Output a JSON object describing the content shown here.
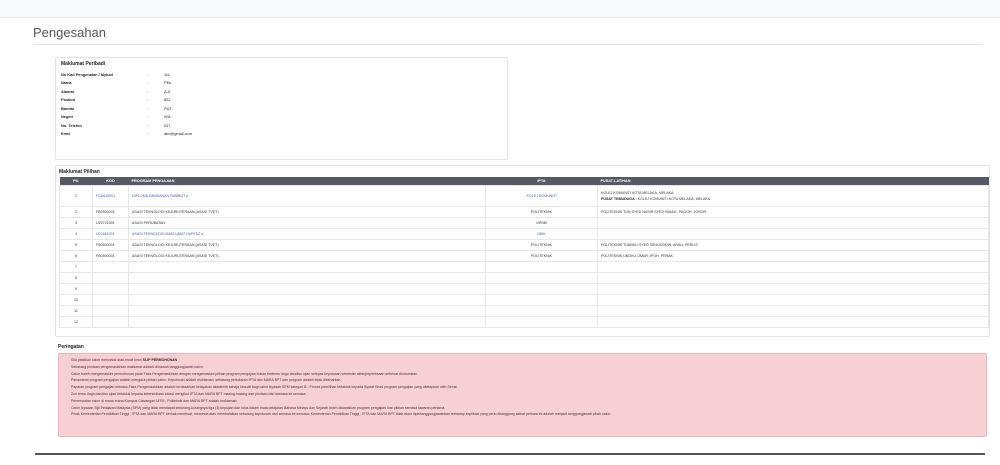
{
  "page": {
    "title": "Pengesahan"
  },
  "personal": {
    "title": "Maklumat Peribadi",
    "separator": ":",
    "fields": [
      {
        "label": "No Kad Pengenalan / Mykad",
        "value": "111"
      },
      {
        "label": "Nama",
        "value": "PEk"
      },
      {
        "label": "Alamat",
        "value": "A-0"
      },
      {
        "label": "Poskod",
        "value": "822"
      },
      {
        "label": "Bandar",
        "value": "PUT"
      },
      {
        "label": "Negeri",
        "value": "WIL"
      },
      {
        "label": "No. Telefon",
        "value": "017"
      },
      {
        "label": "Emel",
        "value": "abc@gmail.com"
      }
    ]
  },
  "choices": {
    "title": "Maklumat Pilihan",
    "headers": {
      "pil": "PIL",
      "kod": "KOD",
      "program": "PROGRAM PENGAJIAN",
      "ipta": "IPTA",
      "pusat": "PUSAT LATIHAN"
    },
    "rows": [
      {
        "pil": "1",
        "kod": "FCA615001",
        "program": "DIPLOMA DANDANAN RAMBUT #",
        "ipta": "KOLEJ KOMUNITI",
        "pusat": "KOLEJ KOMUNITI KOTA MELAKA, MELAKA",
        "pusat_label": "PUSAT TEMUDUGA :",
        "pusat_extra": "KOLEJ KOMUNITI KOTA MELAKA, MELAKA",
        "link": true
      },
      {
        "pil": "2",
        "kod": "FB0500001",
        "program": "ASASI TEKNOLOGI KEJURUTERAAN (ASASI TVET)",
        "ipta": "POLITEKNIK",
        "pusat": "POLITEKNIK TUN SYED NASIR SYED ISMAIL, PAGOH, JOHOR",
        "link": false
      },
      {
        "pil": "3",
        "kod": "UZ0721001",
        "program": "ASASI PERUBATAN",
        "ipta": "UPNM",
        "pusat": "",
        "link": false
      },
      {
        "pil": "4",
        "kod": "UL0481001",
        "program": "ASASI TEKNOLOGI MAKLUMAT HUFFAZ #",
        "ipta": "UNIK",
        "pusat": "",
        "link": true
      },
      {
        "pil": "5",
        "kod": "FB0500001",
        "program": "ASASI TEKNOLOGI KEJURUTERAAN (ASASI TVET)",
        "ipta": "POLITEKNIK",
        "pusat": "POLITEKNIK TUANKU SYED SIRAJUDDIN, ARAU, PERLIS",
        "link": false
      },
      {
        "pil": "6",
        "kod": "FB0500001",
        "program": "ASASI TEKNOLOGI KEJURUTERAAN (ASASI TVET)",
        "ipta": "POLITEKNIK",
        "pusat": "POLITEKNIK UNGKU OMAR, IPOH, PERAK",
        "link": false
      },
      {
        "pil": "7",
        "kod": "",
        "program": "",
        "ipta": "",
        "pusat": "",
        "link": false
      },
      {
        "pil": "8",
        "kod": "",
        "program": "",
        "ipta": "",
        "pusat": "",
        "link": false
      },
      {
        "pil": "9",
        "kod": "",
        "program": "",
        "ipta": "",
        "pusat": "",
        "link": false
      },
      {
        "pil": "10",
        "kod": "",
        "program": "",
        "ipta": "",
        "pusat": "",
        "link": false
      },
      {
        "pil": "11",
        "kod": "",
        "program": "",
        "ipta": "",
        "pusat": "",
        "link": false
      },
      {
        "pil": "12",
        "kod": "",
        "program": "",
        "ipta": "",
        "pusat": "",
        "link": false
      }
    ]
  },
  "warnings": {
    "title": "Peringatan",
    "items": [
      {
        "text": "Sila pastikan calon mencetak atau muat turun ",
        "bold": "SLIP PERMOHONAN"
      },
      {
        "text": "Sebarang pindaan pengemaskinian maklumat adalah di bawah tanggungjawab calon."
      },
      {
        "text": "Calon boleh mengemaskini permohonan pada Fasa Pengemaskinian dengan mengemaskini pilihan program pengajian bukan bertemu dugu dandisu ujian selepas keputusan semester akhir/peperiksaan sebenar diumumkan."
      },
      {
        "text": "Penawaran program pengajian adalah mengikut pilihan calon. Keputusan adalah muktamad, sebarang pertukaran IPTA dan MARA BPT dan program adalah tidak dibenarkan."
      },
      {
        "text": "Paparan program pengajian semasa Fasa Pengemaskinian adalah berdasarkan kelayakan akademik sahaja kecuali bagi calon lepasan SPM kategori B - Proses pemilihan tertakluk kepada Syarat Khas program pengajian yang ditetapkan oleh Senat."
      },
      {
        "text": "Zon temu duga dandisu ujian tertakluk kepada ketersediaan lokasi mengikut IPTA dan MARA BPT masing-masing dan pindaan dari semasa ke semasa."
      },
      {
        "text": "Penempatan calon di mana-mana Kampus Cawangan UiTM , Politeknik dan MARA BPT adalah muktamad."
      },
      {
        "text": "Calon lepasan Sijil Pelajaran Malaysia (SPM) yang tidak mendapat sekurang-kurangnya tiga (3) kepujian dan lulus dalam mata pelajaran Bahasa Melayu dan Sejarah boleh dikawalkan program pengajian luar pilihan semasa tawaran pertama."
      },
      {
        "text": "Pihak Kementerian Pendidikan Tinggi , IPTA dan MARA BPT berhak membuat, meminda atau membatalkan sebarang keputusan dari semasa ke semasa. Kementerian Pendidikan Tinggi , IPTA dan MARA BPT tidak akan dipertanggungjawabkan terhadap implikasi yang perlu ditanggung akibat perkara ini adalah menjadi tanggungjawab pihak calon."
      }
    ]
  }
}
